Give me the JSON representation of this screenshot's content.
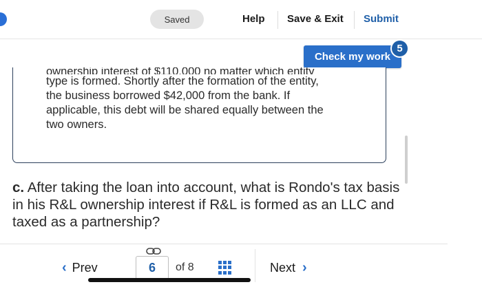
{
  "header": {
    "saved_label": "Saved",
    "help_label": "Help",
    "save_exit_label": "Save & Exit",
    "submit_label": "Submit"
  },
  "check_work": {
    "label": "Check my work",
    "remaining_count": "5"
  },
  "scenario": {
    "cut_line": "ownership interest of $110,000 no matter which entity",
    "lines": [
      "type is formed. Shortly after the formation of the entity,",
      "the business borrowed $42,000 from the bank. If",
      "applicable, this debt will be shared equally between the",
      "two owners."
    ]
  },
  "question": {
    "letter": "c.",
    "text": "After taking the loan into account, what is Rondo's tax basis in his R&L ownership interest if R&L is formed as an LLC and taxed as a partnership?"
  },
  "pager": {
    "prev_label": "Prev",
    "current_page": "6",
    "of_text": "of 8",
    "next_label": "Next"
  },
  "colors": {
    "accent": "#2a6fc9",
    "submit": "#1f5fa8"
  },
  "icons": [
    "link-icon",
    "grid-icon",
    "chevron-left-icon",
    "chevron-right-icon"
  ]
}
